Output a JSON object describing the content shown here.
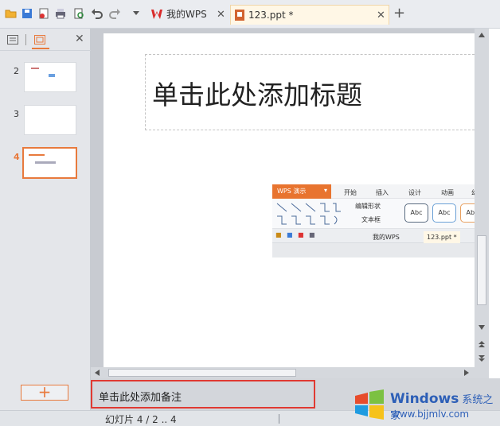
{
  "toolbar": {
    "icons": [
      "open-folder-icon",
      "save-icon",
      "pdf-export-icon",
      "print-icon",
      "print-preview-icon",
      "undo-icon",
      "redo-icon",
      "more-dropdown-icon"
    ]
  },
  "tabs": [
    {
      "label": "我的WPS",
      "icon": "wps-logo-icon",
      "closable": true
    },
    {
      "label": "123.ppt *",
      "icon": "ppt-file-icon",
      "closable": true,
      "active": true
    }
  ],
  "new_tab_glyph": "+",
  "close_glyph": "✕",
  "left_panel": {
    "close_glyph": "✕",
    "thumbnails": [
      {
        "number": "2"
      },
      {
        "number": "3"
      },
      {
        "number": "4",
        "selected": true
      }
    ],
    "add_glyph": "+"
  },
  "slide": {
    "title_placeholder": "单击此处添加标题",
    "embedded_screenshot": {
      "logo": "WPS 演示",
      "menu": [
        "开始",
        "插入",
        "设计",
        "动画",
        "幻"
      ],
      "edit_shape": "编辑形状",
      "textbox": "文本框",
      "style_label": "Abc",
      "tab_wps": "我的WPS",
      "tab_ppt": "123.ppt *"
    }
  },
  "notes": {
    "placeholder": "单击此处添加备注"
  },
  "status": {
    "slide_info": "幻灯片 4 / 2 .. 4"
  },
  "watermark": {
    "brand": "Windows",
    "brand_cn": "系统之家",
    "url": "www.bjjmlv.com"
  },
  "colors": {
    "accent": "#e87a3d",
    "highlight_box": "#e03a32",
    "wps_red": "#d92b2b"
  }
}
